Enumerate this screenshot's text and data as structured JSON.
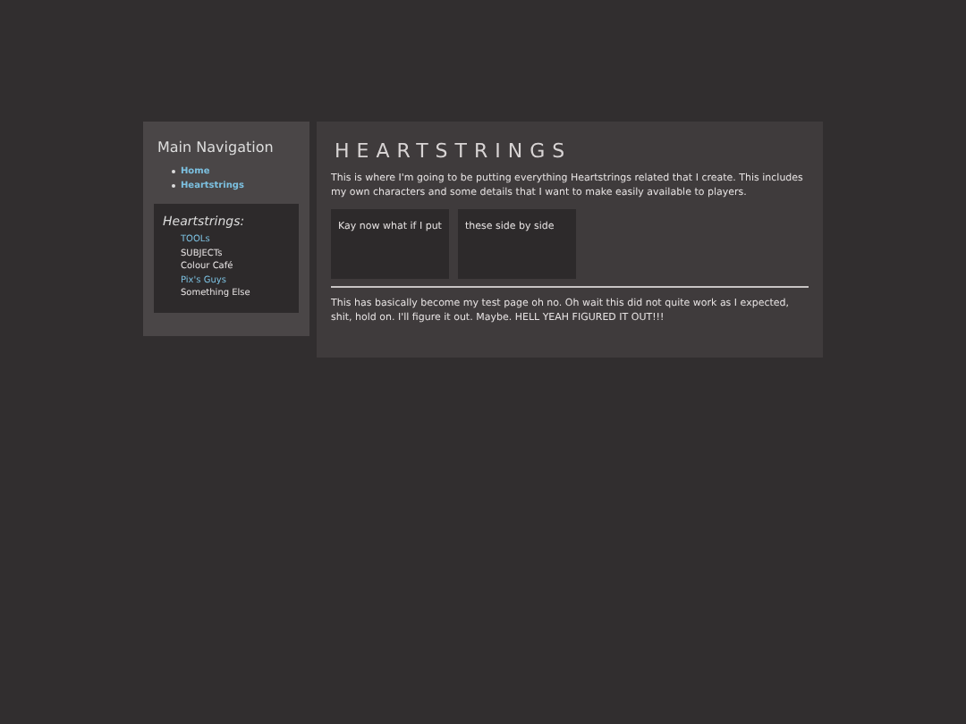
{
  "sidebar": {
    "title": "Main Navigation",
    "links": [
      "Home",
      "Heartstrings"
    ],
    "box": {
      "title": "Heartstrings:",
      "items": [
        {
          "label": "TOOLs",
          "kind": "link"
        },
        {
          "label": "SUBJECTs",
          "kind": "text"
        },
        {
          "label": "Colour Café",
          "kind": "text"
        },
        {
          "label": "Pix's Guys",
          "kind": "link"
        },
        {
          "label": "Something Else",
          "kind": "text"
        }
      ]
    }
  },
  "main": {
    "title": "HEARTSTRINGS",
    "intro": "This is where I'm going to be putting everything Heartstrings related that I create. This includes my own characters and some details that I want to make easily available to players.",
    "cards": [
      "Kay now what if I put",
      "these side by side"
    ],
    "footer": "This has basically become my test page oh no. Oh wait this did not quite work as I expected, shit, hold on. I'll figure it out. Maybe. HELL YEAH FIGURED IT OUT!!!"
  }
}
